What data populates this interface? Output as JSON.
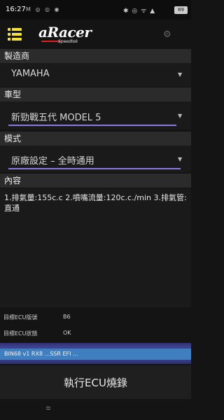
{
  "status_bar": {
    "time": "16:27",
    "left_icons": "M ◎ ◎ ◉",
    "right_icons": "✱ ◎ ᯤ ▲",
    "battery": "89"
  },
  "header": {
    "logo_text": "aRacer",
    "logo_sub": "Speedtek"
  },
  "manufacturer": {
    "header": "製造商",
    "value": "YAMAHA"
  },
  "model": {
    "header": "車型",
    "value": "新勁戰五代 MODEL 5"
  },
  "mode": {
    "header": "模式",
    "value": "原廠設定 – 全時通用"
  },
  "content": {
    "header": "內容",
    "text": "1.排氣量:155c.c  2.噴嘴流量:120c.c./min 3.排氣管: 直通"
  },
  "info": {
    "ecu_version_label": "目標ECU版號",
    "ecu_version_value": "B6",
    "ecu_status_label": "目標ECU狀態",
    "ecu_status_value": "OK"
  },
  "status_strip": {
    "text": "BIN68  v1  RX8  ...SSR  EFI  ..."
  },
  "exec_button": {
    "label": "執行ECU燒錄"
  },
  "colors": {
    "accent_yellow": "#f3e23c",
    "underline_purple": "#8a7ae0",
    "status_blue": "#3f7fc0"
  }
}
